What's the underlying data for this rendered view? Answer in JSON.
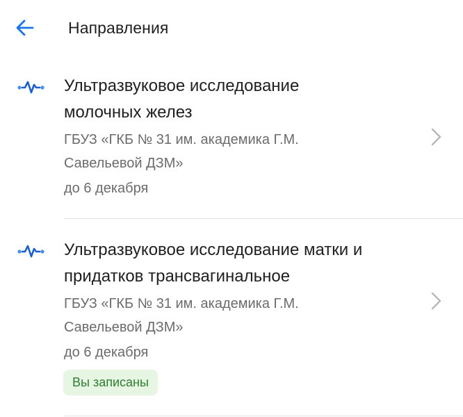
{
  "header": {
    "title": "Направления",
    "back_icon": "arrow-left-icon",
    "accent_color": "#1a73e8"
  },
  "referrals": [
    {
      "icon": "ultrasound-wave-icon",
      "title_line1": "Ультразвуковое исследование",
      "title_line2": "молочных желез",
      "org_line1": "ГБУЗ «ГКБ № 31 им. академика Г.М.",
      "org_line2": "Савельевой ДЗМ»",
      "due": "до 6 декабря"
    },
    {
      "icon": "ultrasound-wave-icon",
      "title_line1": "Ультразвуковое исследование матки и",
      "title_line2": "придатков трансвагинальное",
      "org_line1": "ГБУЗ «ГКБ № 31 им. академика Г.М.",
      "org_line2": "Савельевой ДЗМ»",
      "due": "до 6 декабря",
      "status": "Вы записаны",
      "status_color": "#2e7d32"
    }
  ]
}
